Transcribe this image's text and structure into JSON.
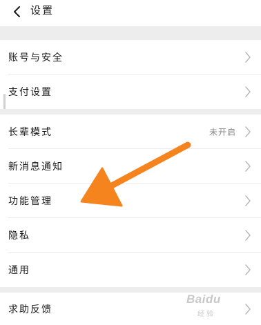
{
  "header": {
    "title": "设置",
    "back_icon": "chevron-left-icon"
  },
  "settings": {
    "account_security": "账号与安全",
    "payment": "支付设置",
    "elder_mode": {
      "label": "长辈模式",
      "value": "未开启"
    },
    "notifications": "新消息通知",
    "feature_management": "功能管理",
    "privacy": "隐私",
    "general": "通用",
    "help_feedback": "求助反馈"
  },
  "annotation": {
    "arrow_color": "#f5841f",
    "icon": "arrow-pointer-icon"
  },
  "watermark": {
    "brand": "Baidu",
    "sub": "经验"
  },
  "colors": {
    "section_gap": "#ededed",
    "row_background": "#ffffff",
    "divider": "#ececec",
    "chevron": "#b8b8b8",
    "muted_text": "#888888"
  }
}
